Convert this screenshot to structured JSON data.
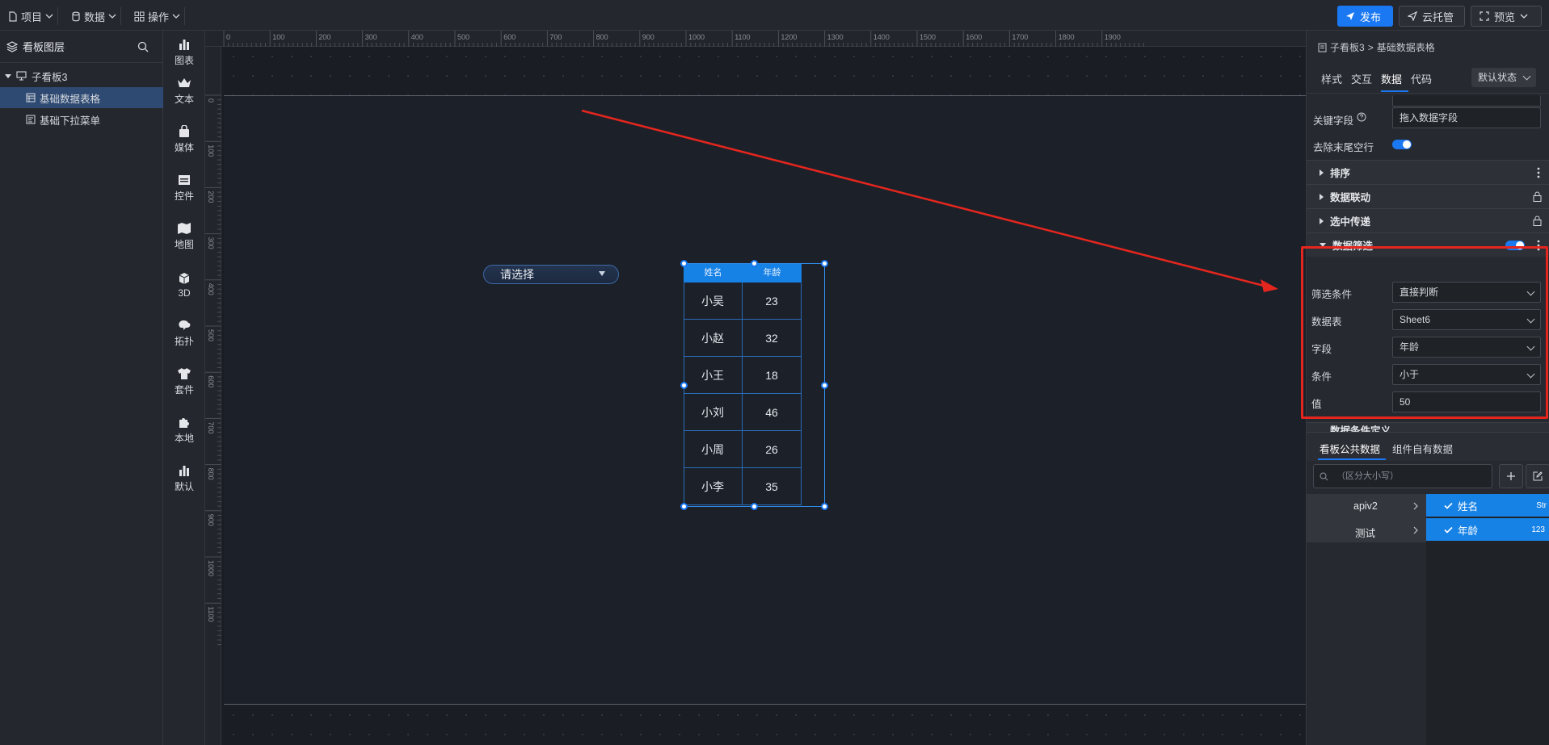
{
  "topbar": {
    "menus": [
      {
        "label": "项目",
        "icon": "file-icon"
      },
      {
        "label": "数据",
        "icon": "database-icon"
      },
      {
        "label": "操作",
        "icon": "grid-icon"
      }
    ],
    "publish_label": "发布",
    "cloud_label": "云托管",
    "preview_label": "预览"
  },
  "layers": {
    "title": "看板图层",
    "root": "子看板3",
    "items": [
      "基础数据表格",
      "基础下拉菜单"
    ]
  },
  "rail": {
    "items": [
      "图表",
      "文本",
      "媒体",
      "控件",
      "地图",
      "3D",
      "拓扑",
      "套件",
      "本地",
      "默认"
    ]
  },
  "ruler": {
    "top_ticks": [
      "0",
      "100",
      "200",
      "300",
      "400",
      "500",
      "600",
      "700",
      "800",
      "900",
      "1000",
      "1100",
      "1200",
      "1300",
      "1400",
      "1500",
      "1600",
      "1700",
      "1800",
      "1900"
    ],
    "left_ticks": [
      "0",
      "100",
      "200",
      "300",
      "400",
      "500",
      "600",
      "700",
      "800",
      "900",
      "1000",
      "1100"
    ]
  },
  "canvas": {
    "select_placeholder": "请选择",
    "table": {
      "headers": [
        "姓名",
        "年龄"
      ],
      "rows": [
        [
          "小吴",
          "23"
        ],
        [
          "小赵",
          "32"
        ],
        [
          "小王",
          "18"
        ],
        [
          "小刘",
          "46"
        ],
        [
          "小周",
          "26"
        ],
        [
          "小李",
          "35"
        ]
      ]
    }
  },
  "right": {
    "breadcrumb_root": "子看板3",
    "breadcrumb_current": "基础数据表格",
    "tabs": [
      "样式",
      "交互",
      "数据",
      "代码"
    ],
    "state_label": "默认状态",
    "key_field_label": "关键字段",
    "key_field_placeholder": "拖入数据字段",
    "trim_label": "去除末尾空行",
    "sections": {
      "sort": "排序",
      "link": "数据联动",
      "pass": "选中传递",
      "filter": "数据筛选",
      "partial": "数据条件定义"
    },
    "filter": {
      "condition_type_label": "筛选条件",
      "condition_type_value": "直接判断",
      "table_label": "数据表",
      "table_value": "Sheet6",
      "field_label": "字段",
      "field_value": "年龄",
      "op_label": "条件",
      "op_value": "小于",
      "value_label": "值",
      "value_value": "50"
    },
    "bottom_tabs": [
      "看板公共数据",
      "组件自有数据"
    ],
    "search_placeholder": "（区分大小写）",
    "sources": [
      "apiv2",
      "测试"
    ],
    "fields": [
      {
        "name": "姓名",
        "type": "Str"
      },
      {
        "name": "年龄",
        "type": "123"
      }
    ]
  },
  "colors": {
    "accent": "#1a78f2",
    "highlight": "#e5261e"
  }
}
